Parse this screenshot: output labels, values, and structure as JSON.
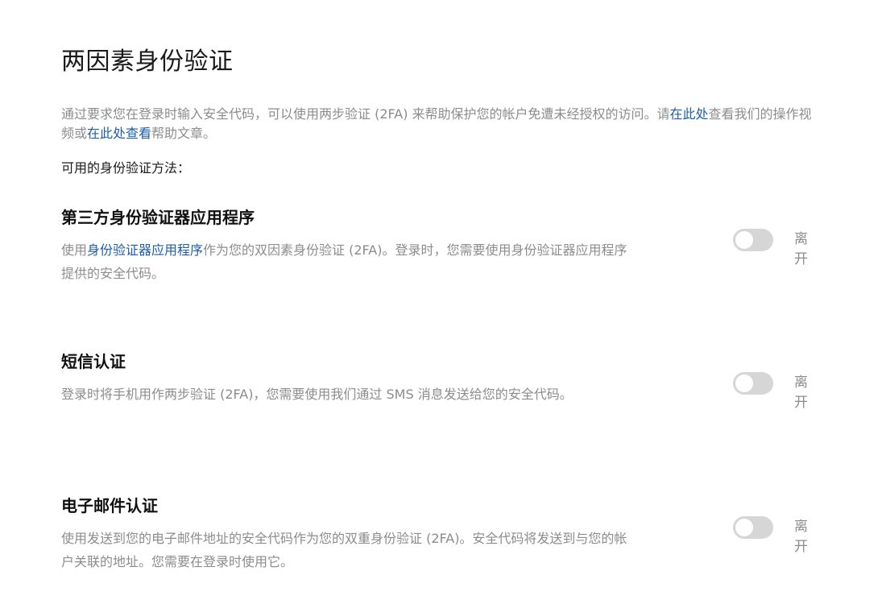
{
  "page": {
    "title": "两因素身份验证",
    "intro": {
      "part1": "通过要求您在登录时输入安全代码，可以使用两步验证 (2FA) 来帮助保护您的帐户免遭未经授权的访问。请",
      "link1": "在此处",
      "part2": "查看我们的操作视频或",
      "link2": "在此处查看",
      "part3": "帮助文章。"
    },
    "methods_label": "可用的身份验证方法："
  },
  "methods": [
    {
      "title": "第三方身份验证器应用程序",
      "desc_before": "使用",
      "desc_link": "身份验证器应用程序",
      "desc_after": "作为您的双因素身份验证 (2FA)。登录时，您需要使用身份验证器应用程序提供的安全代码。",
      "toggle_on": false,
      "state_label": "离开"
    },
    {
      "title": "短信认证",
      "desc": "登录时将手机用作两步验证 (2FA)，您需要使用我们通过 SMS 消息发送给您的安全代码。",
      "toggle_on": false,
      "state_label": "离开"
    },
    {
      "title": "电子邮件认证",
      "desc": "使用发送到您的电子邮件地址的安全代码作为您的双重身份验证 (2FA)。安全代码将发送到与您的帐户关联的地址。您需要在登录时使用它。",
      "toggle_on": false,
      "state_label": "离开"
    }
  ]
}
